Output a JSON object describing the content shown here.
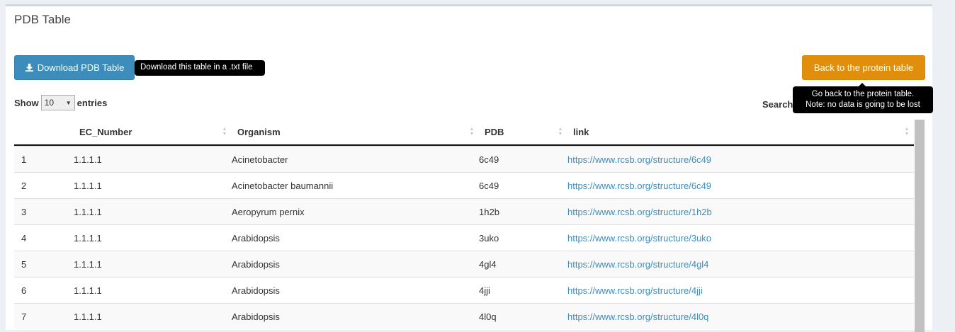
{
  "panel": {
    "title": "PDB Table"
  },
  "download_button": {
    "label": "Download PDB Table",
    "tooltip": "Download this table in a .txt file"
  },
  "back_button": {
    "label": "Back to the protein table",
    "tooltip_line1": "Go back to the protein table.",
    "tooltip_line2": "Note: no data is going to be lost"
  },
  "length": {
    "show": "Show",
    "value": "10",
    "entries": "entries"
  },
  "search": {
    "label": "Search"
  },
  "table": {
    "headers": [
      "",
      "EC_Number",
      "Organism",
      "PDB",
      "link"
    ],
    "rows": [
      [
        "1",
        "1.1.1.1",
        "Acinetobacter",
        "6c49",
        "https://www.rcsb.org/structure/6c49"
      ],
      [
        "2",
        "1.1.1.1",
        "Acinetobacter baumannii",
        "6c49",
        "https://www.rcsb.org/structure/6c49"
      ],
      [
        "3",
        "1.1.1.1",
        "Aeropyrum pernix",
        "1h2b",
        "https://www.rcsb.org/structure/1h2b"
      ],
      [
        "4",
        "1.1.1.1",
        "Arabidopsis",
        "3uko",
        "https://www.rcsb.org/structure/3uko"
      ],
      [
        "5",
        "1.1.1.1",
        "Arabidopsis",
        "4gl4",
        "https://www.rcsb.org/structure/4gl4"
      ],
      [
        "6",
        "1.1.1.1",
        "Arabidopsis",
        "4jji",
        "https://www.rcsb.org/structure/4jji"
      ],
      [
        "7",
        "1.1.1.1",
        "Arabidopsis",
        "4l0q",
        "https://www.rcsb.org/structure/4l0q"
      ]
    ]
  },
  "colors": {
    "primary": "#3c8dbc",
    "warning": "#e08e0b"
  }
}
